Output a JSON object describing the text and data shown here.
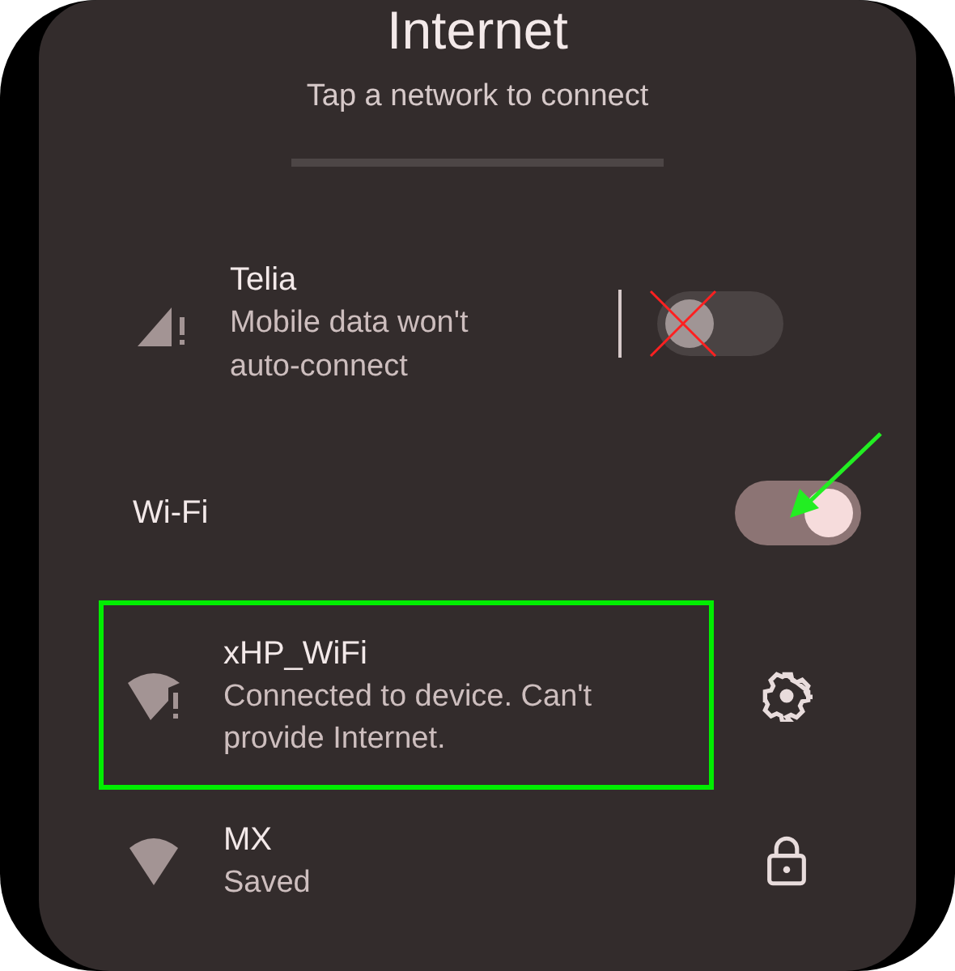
{
  "title": "Internet",
  "subtitle": "Tap a network to connect",
  "mobile": {
    "name": "Telia",
    "status": "Mobile data won't auto-connect",
    "on": false,
    "crossed_out": true
  },
  "wifi": {
    "label": "Wi-Fi",
    "on": true,
    "arrow_annotation": true
  },
  "networks": [
    {
      "name": "xHP_WiFi",
      "status": "Connected to device. Can't provide Internet.",
      "warning": true,
      "kind": "settings",
      "highlighted": true
    },
    {
      "name": "MX",
      "status": "Saved",
      "warning": false,
      "kind": "locked",
      "highlighted": false
    }
  ]
}
